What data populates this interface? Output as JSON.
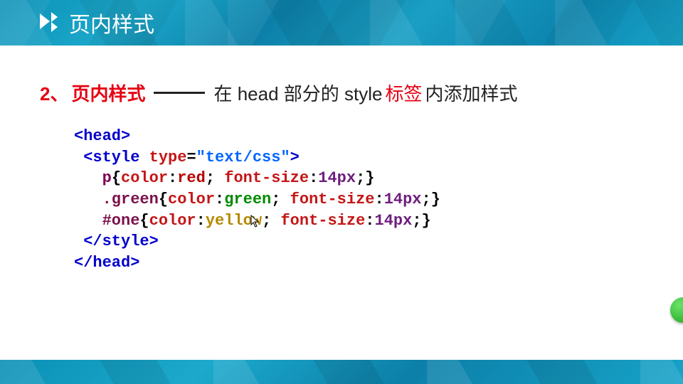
{
  "header": {
    "title": "页内样式"
  },
  "heading": {
    "number": "2、",
    "keyword": "页内样式",
    "pre": "在 head 部分的 style ",
    "kw_red": "标签",
    "post": "内添加样式"
  },
  "code": {
    "l1": {
      "open": "<head>"
    },
    "l2": {
      "open": "<style",
      "attr_name": "type",
      "eq": "=",
      "attr_val": "\"text/css\"",
      "close": ">"
    },
    "l3": {
      "sel": "p",
      "ob": "{",
      "p1": "color",
      "c1": ":",
      "v1": "red",
      "s1": ";",
      "sp": " ",
      "p2": "font-size",
      "c2": ":",
      "v2": "14px",
      "s2": ";",
      "cb": "}"
    },
    "l4": {
      "sel": ".green",
      "ob": "{",
      "p1": "color",
      "c1": ":",
      "v1": "green",
      "s1": ";",
      "sp": " ",
      "p2": "font-size",
      "c2": ":",
      "v2": "14px",
      "s2": ";",
      "cb": "}"
    },
    "l5": {
      "sel": "#one",
      "ob": "{",
      "p1": "color",
      "c1": ":",
      "v1": "yellow",
      "s1": ";",
      "sp": " ",
      "p2": "font-size",
      "c2": ":",
      "v2": "14px",
      "s2": ";",
      "cb": "}"
    },
    "l6": {
      "close": "</style>"
    },
    "l7": {
      "close": "</head>"
    }
  }
}
